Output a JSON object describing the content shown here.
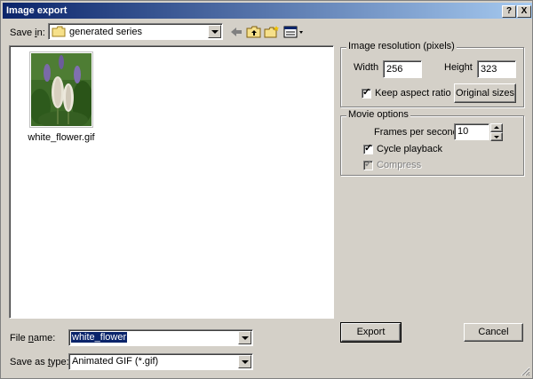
{
  "window": {
    "title": "Image export",
    "help_btn": "?",
    "close_btn": "X"
  },
  "toolbar": {
    "save_in_label": "Save in:",
    "save_in_value": "generated series"
  },
  "files": [
    {
      "name": "white_flower.gif"
    }
  ],
  "filename": {
    "label": "File name:",
    "value": "white_flower"
  },
  "filetype": {
    "label": "Save as type:",
    "value": "Animated GIF (*.gif)"
  },
  "resolution": {
    "title": "Image resolution (pixels)",
    "width_label": "Width",
    "width_value": "256",
    "height_label": "Height",
    "height_value": "323",
    "keep_aspect_label": "Keep aspect ratio",
    "keep_aspect_checked": true,
    "original_sizes_label": "Original sizes"
  },
  "movie": {
    "title": "Movie options",
    "fps_label": "Frames per second",
    "fps_value": "10",
    "cycle_label": "Cycle playback",
    "cycle_checked": true,
    "compress_label": "Compress",
    "compress_checked": true,
    "compress_enabled": false
  },
  "actions": {
    "export_label": "Export",
    "cancel_label": "Cancel"
  }
}
